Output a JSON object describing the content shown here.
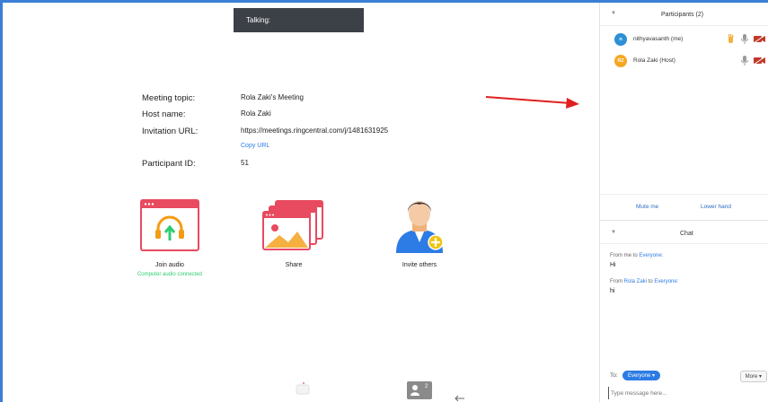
{
  "status": {
    "talking": "Talking:"
  },
  "meeting": {
    "topic_label": "Meeting topic:",
    "topic": "Rola Zaki's Meeting",
    "host_label": "Host name:",
    "host": "Rola Zaki",
    "url_label": "Invitation URL:",
    "url": "https://meetings.ringcentral.com/j/1481631925",
    "copy_url": "Copy URL",
    "pid_label": "Participant ID:",
    "pid": "51"
  },
  "actions": {
    "join_audio": "Join audio",
    "join_audio_status": "Computer audio connected",
    "share": "Share",
    "invite": "Invite others"
  },
  "bottom": {
    "participants_count": "2"
  },
  "participants": {
    "title": "Participants (2)",
    "list": [
      {
        "initials": "n",
        "name": "nithyavasanth (me)",
        "color": "#2d8fd6"
      },
      {
        "initials": "RZ",
        "name": "Rola Zaki (Host)",
        "color": "#f5a623"
      }
    ],
    "mute_me": "Mute me",
    "lower_hand": "Lower hand"
  },
  "chat": {
    "title": "Chat",
    "messages": [
      {
        "from_prefix": "From me to ",
        "from_name": "",
        "to_mid": "",
        "to_name": "Everyone:",
        "text": "Hi"
      },
      {
        "from_prefix": "From ",
        "from_name": "Rola Zaki",
        "to_mid": " to ",
        "to_name": "Everyone:",
        "text": "hi"
      }
    ],
    "to_label": "To:",
    "to_value": "Everyone ▾",
    "more": "More ▾",
    "placeholder": "Type message here..."
  },
  "colors": {
    "accent": "#2d7be5",
    "arrow": "#e02020",
    "hand": "#f5b041",
    "flag": "#c0392b"
  }
}
